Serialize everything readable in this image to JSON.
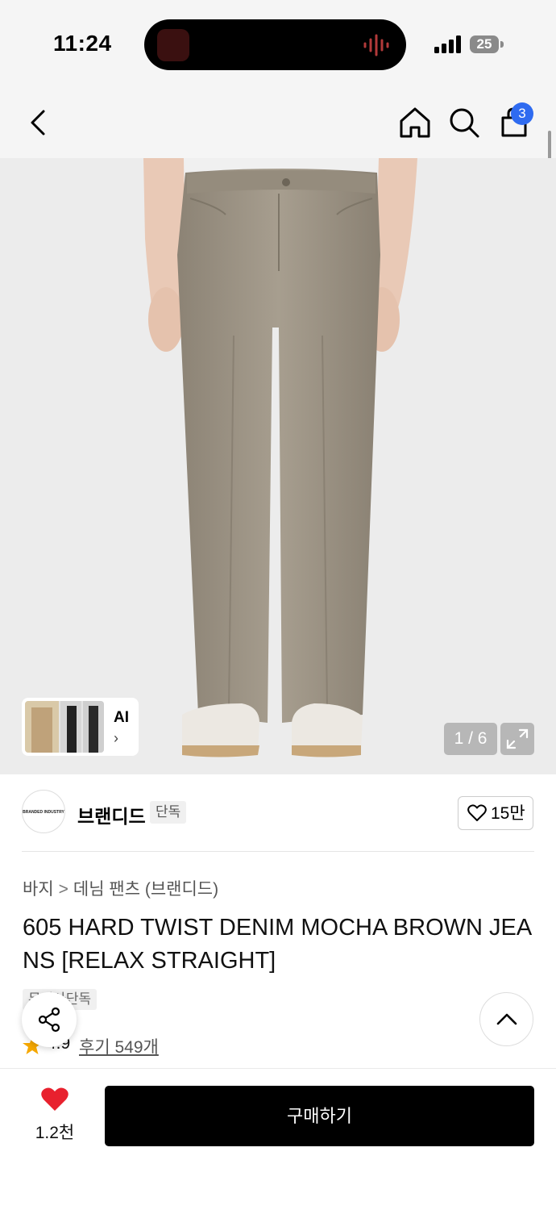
{
  "status_bar": {
    "time": "11:24",
    "battery_level": "25",
    "signal_icon": "cellular-signal-icon",
    "battery_icon": "battery-icon"
  },
  "nav": {
    "back_icon": "chevron-left-icon",
    "home_icon": "home-icon",
    "search_icon": "search-icon",
    "cart_icon": "shopping-bag-icon",
    "cart_count": "3"
  },
  "gallery": {
    "ai_label": "AI",
    "ai_chevron": "›",
    "page_indicator": "1 / 6",
    "expand_icon": "expand-icon"
  },
  "brand": {
    "logo_text": "BRANDED INDUSTRY",
    "name": "브랜디드",
    "exclusive_tag": "단독",
    "like_count": "15만"
  },
  "product": {
    "breadcrumb": [
      "바지",
      "데님 팬츠 (브랜디드)"
    ],
    "breadcrumb_separator": ">",
    "title": "605 HARD TWIST DENIM MOCHA BROWN JEANS [RELAX STRAIGHT]",
    "exclusive_label": "무신사단독",
    "rating": "4.9",
    "review_link": "후기 549개"
  },
  "floating": {
    "share_icon": "share-icon",
    "top_icon": "chevron-up-icon"
  },
  "bottom_bar": {
    "wish_count": "1.2천",
    "buy_label": "구매하기"
  },
  "colors": {
    "accent_badge": "#2f6bf0",
    "wish_red": "#e8212e",
    "star": "#f6a800",
    "denim": "#9c9384"
  }
}
